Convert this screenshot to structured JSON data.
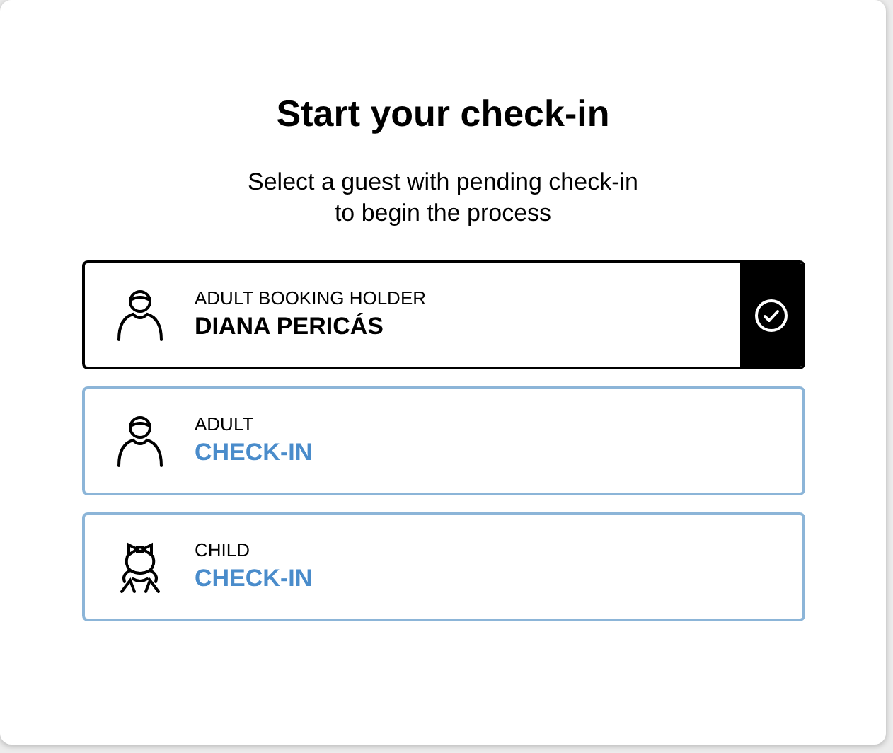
{
  "title": "Start your check-in",
  "subtitle_lines": [
    "Select a guest with pending check-in",
    "to begin the process"
  ],
  "guests": [
    {
      "kind": "adult",
      "role": "ADULT BOOKING HOLDER",
      "name": "DIANA PERICÁS",
      "selected": true
    },
    {
      "kind": "adult",
      "role": "ADULT",
      "name": "CHECK-IN",
      "selected": false
    },
    {
      "kind": "child",
      "role": "CHILD",
      "name": "CHECK-IN",
      "selected": false
    }
  ]
}
